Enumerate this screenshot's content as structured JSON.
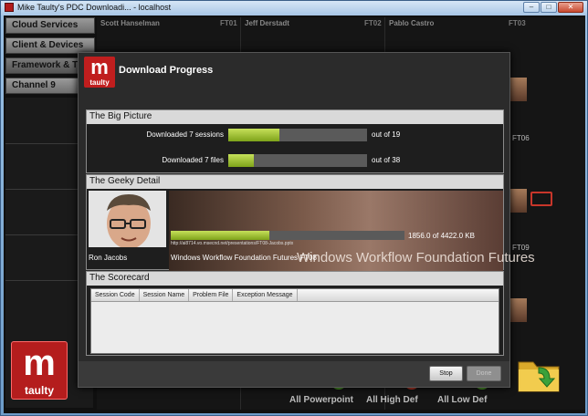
{
  "window": {
    "title": "Mike Taulty's PDC Downloadi... - localhost",
    "minimize": "–",
    "maximize": "□",
    "close": "✕"
  },
  "menu": {
    "items": [
      {
        "label": "Cloud Services"
      },
      {
        "label": "Client & Devices"
      },
      {
        "label": "Framework & To"
      },
      {
        "label": "Channel 9"
      }
    ]
  },
  "tiles": {
    "headers": [
      {
        "name": "Scott Hanselman",
        "code": "FT01"
      },
      {
        "name": "Jeff Derstadt",
        "code": "FT02"
      },
      {
        "name": "Pablo Castro",
        "code": "FT03"
      }
    ],
    "side_labels": [
      "FT06",
      "FT09"
    ]
  },
  "logo": {
    "letter": "m",
    "word": "taulty"
  },
  "bottom_actions": [
    {
      "label": "All Powerpoint",
      "color": "#4e9a2a"
    },
    {
      "label": "All High Def",
      "color": "#c03a2a"
    },
    {
      "label": "All Low Def",
      "color": "#4e9a2a"
    }
  ],
  "dialog": {
    "title": "Download Progress",
    "big_picture": {
      "heading": "The Big Picture",
      "sessions": {
        "label": "Downloaded 7 sessions",
        "of": "out of 19",
        "progress": 0.368
      },
      "files": {
        "label": "Downloaded 7 files",
        "of": "out of 38",
        "progress": 0.184
      }
    },
    "geeky_detail": {
      "heading": "The Geeky Detail",
      "speaker": "Ron Jacobs",
      "session": "Windows Workflow Foundation Futures FT08",
      "session_overlay": "Windows Workflow Foundation Futures",
      "url": "http://ai8714.vo.msecnd.net/presentations/FT08-Jacobs.pptx",
      "size": "1856.0 of 4422.0 KB",
      "progress": 0.42
    },
    "scorecard": {
      "heading": "The Scorecard",
      "columns": [
        "Session Code",
        "Session Name",
        "Problem File",
        "Exception Message"
      ]
    },
    "buttons": {
      "stop": "Stop",
      "done": "Done"
    }
  },
  "colors": {
    "accent_red": "#c01e1e",
    "progress_green": "#9cc41e"
  }
}
